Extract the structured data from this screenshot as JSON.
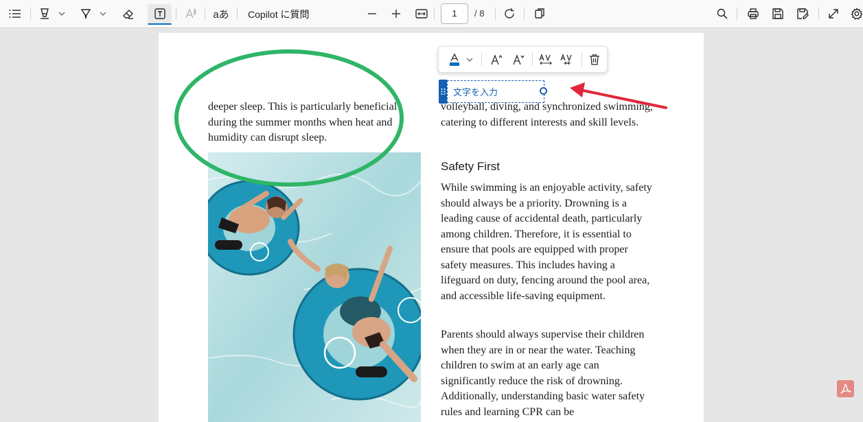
{
  "toolbar": {
    "copilot_label": "Copilot に質問",
    "page_current": "1",
    "page_total": "/ 8",
    "translate_glyph": "aあ"
  },
  "page": {
    "left_paragraph": "deeper sleep. This is particularly beneficial during the summer months when heat and humidity can disrupt sleep.",
    "right_paragraph_top": "volleyball, diving, and synchronized swimming, catering to different interests and skill levels.",
    "heading": "Safety First",
    "right_paragraph_1": "While swimming is an enjoyable activity, safety should always be a priority. Drowning is a leading cause of accidental death, particularly among children. Therefore, it is essential to ensure that pools are equipped with proper safety measures. This includes having a lifeguard on duty, fencing around the pool area, and accessible life-saving equipment.",
    "right_paragraph_2": "Parents should always supervise their children when they are in or near the water. Teaching children to swim at an early age can significantly reduce the risk of drowning. Additionally, understanding basic water safety rules and learning CPR can be"
  },
  "textbox": {
    "placeholder": "文字を入力"
  },
  "colors": {
    "accent": "#0f6cbd",
    "annotation_green": "#2fb567",
    "annotation_red": "#e0283a"
  }
}
